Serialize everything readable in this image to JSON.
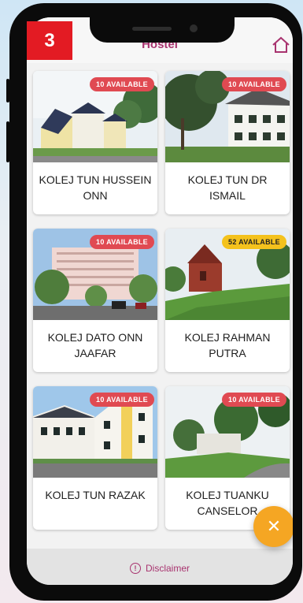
{
  "tutorial": {
    "step": "3"
  },
  "appbar": {
    "title": "Hostel"
  },
  "hostels": [
    {
      "name": "KOLEJ TUN HUSSEIN ONN",
      "availability": "10 AVAILABLE",
      "badge_color": "#e04a52"
    },
    {
      "name": "KOLEJ TUN DR ISMAIL",
      "availability": "10 AVAILABLE",
      "badge_color": "#e04a52"
    },
    {
      "name": "KOLEJ DATO ONN JAAFAR",
      "availability": "10 AVAILABLE",
      "badge_color": "#e04a52"
    },
    {
      "name": "KOLEJ RAHMAN PUTRA",
      "availability": "52 AVAILABLE",
      "badge_color": "#f4c21d"
    },
    {
      "name": "KOLEJ TUN RAZAK",
      "availability": "10 AVAILABLE",
      "badge_color": "#e04a52"
    },
    {
      "name": "KOLEJ TUANKU CANSELOR",
      "availability": "10 AVAILABLE",
      "badge_color": "#e04a52"
    }
  ],
  "footer": {
    "disclaimer": "Disclaimer"
  },
  "fab": {
    "icon": "close-icon",
    "color": "#f5a623"
  },
  "colors": {
    "brand": "#a8336f"
  }
}
